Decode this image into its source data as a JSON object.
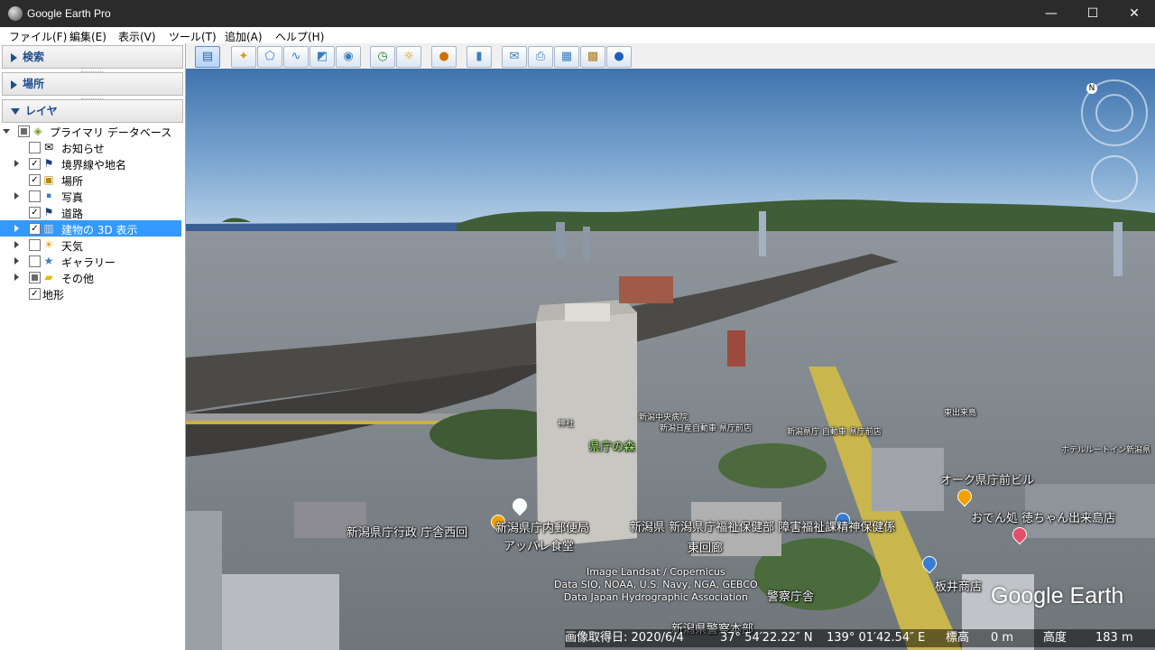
{
  "window": {
    "title": "Google Earth Pro",
    "minimize": "—",
    "maximize": "☐",
    "close": "✕"
  },
  "menu": [
    "ファイル(F)",
    "編集(E)",
    "表示(V)",
    "ツール(T)",
    "追加(A)",
    "ヘルプ(H)"
  ],
  "panels": {
    "search": "検索",
    "places": "場所",
    "layers": "レイヤ"
  },
  "layers": {
    "root": "プライマリ データベース",
    "items": [
      {
        "label": "お知らせ",
        "icon": "envelope-icon",
        "checked": false
      },
      {
        "label": "境界線や地名",
        "icon": "flag-icon",
        "checked": true
      },
      {
        "label": "場所",
        "icon": "place-square-icon",
        "checked": true
      },
      {
        "label": "写真",
        "icon": "photo-icon",
        "checked": false
      },
      {
        "label": "道路",
        "icon": "flag-icon",
        "checked": true
      },
      {
        "label": "建物の 3D 表示",
        "icon": "building-icon",
        "checked": true,
        "selected": true
      },
      {
        "label": "天気",
        "icon": "sun-icon",
        "checked": false
      },
      {
        "label": "ギャラリー",
        "icon": "star-icon",
        "checked": false
      },
      {
        "label": "その他",
        "icon": "folder-icon",
        "checked": "partial"
      },
      {
        "label": "地形",
        "icon": "",
        "checked": true
      }
    ]
  },
  "toolbar": {
    "buttons": [
      "sidebar-toggle-icon",
      "placemark-icon",
      "polygon-icon",
      "path-icon",
      "overlay-icon",
      "tour-icon",
      "historical-imagery-icon",
      "sunlight-icon",
      "planets-icon",
      "ruler-icon",
      "email-icon",
      "print-icon",
      "save-image-icon",
      "maps-icon",
      "globe-icon"
    ]
  },
  "map": {
    "labels": {
      "kencho_mori": "県庁の森",
      "west_office": "新潟県庁行政 庁舎西回",
      "post_office": "新潟県庁内郵便局",
      "apple_shokudo": "アッパレ食堂",
      "east_gallery": "東回廊",
      "welfare": "新潟県 新潟県庁福祉保健部 障害福祉課精神保健係",
      "okan": "おでん処 徳ちゃん出来島店",
      "ogu": "オーク県庁前ビル",
      "itai": "板井商店",
      "police": "警察庁舎",
      "keisatsu_honbu": "新潟県警察本部",
      "hotel": "ホテルルートイン新潟県",
      "higashi_dekijima": "東出来島",
      "chuo_hospital": "新潟中央病院",
      "jidosha": "新潟日産自動車 県庁前店",
      "kencho_mae": "新潟県庁 自動車 県庁前店",
      "jinja": "神社"
    },
    "credits": [
      "Image Landsat / Copernicus",
      "Data SIO, NOAA, U.S. Navy, NGA, GEBCO",
      "Data Japan Hydrographic Association"
    ],
    "logo": "Google Earth",
    "status": {
      "imagery_date": "画像取得日: 2020/6/4",
      "lat": "37° 54′22.22″ N",
      "lon": "139° 01′42.54″ E",
      "elevation": "標高",
      "elevation_value": "0 m",
      "eye_alt_label": "高度",
      "eye_alt_value": "183 m"
    },
    "compass": "N"
  }
}
